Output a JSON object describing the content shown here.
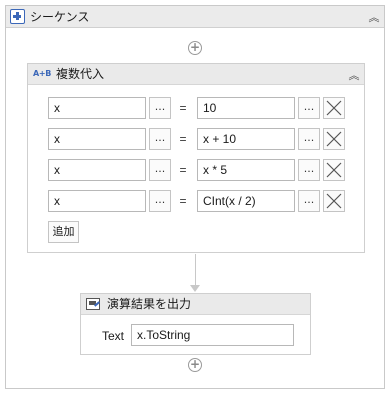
{
  "sequence": {
    "title": "シーケンス",
    "collapse_glyph": "︽"
  },
  "multi_assign": {
    "title": "複数代入",
    "icon_text": "A+B",
    "collapse_glyph": "︽",
    "rows": [
      {
        "to": "x",
        "value": "10"
      },
      {
        "to": "x",
        "value": "x + 10"
      },
      {
        "to": "x",
        "value": "x * 5"
      },
      {
        "to": "x",
        "value": "CInt(x / 2)"
      }
    ],
    "dots_label": "...",
    "equals_label": "=",
    "add_label": "追加"
  },
  "write_line": {
    "title": "演算結果を出力",
    "text_label": "Text",
    "text_value": "x.ToString"
  },
  "plus_glyph": "+",
  "colors": {
    "header_bg": "#ebebeb",
    "border": "#c9c9c9",
    "accent": "#3b67b8"
  }
}
